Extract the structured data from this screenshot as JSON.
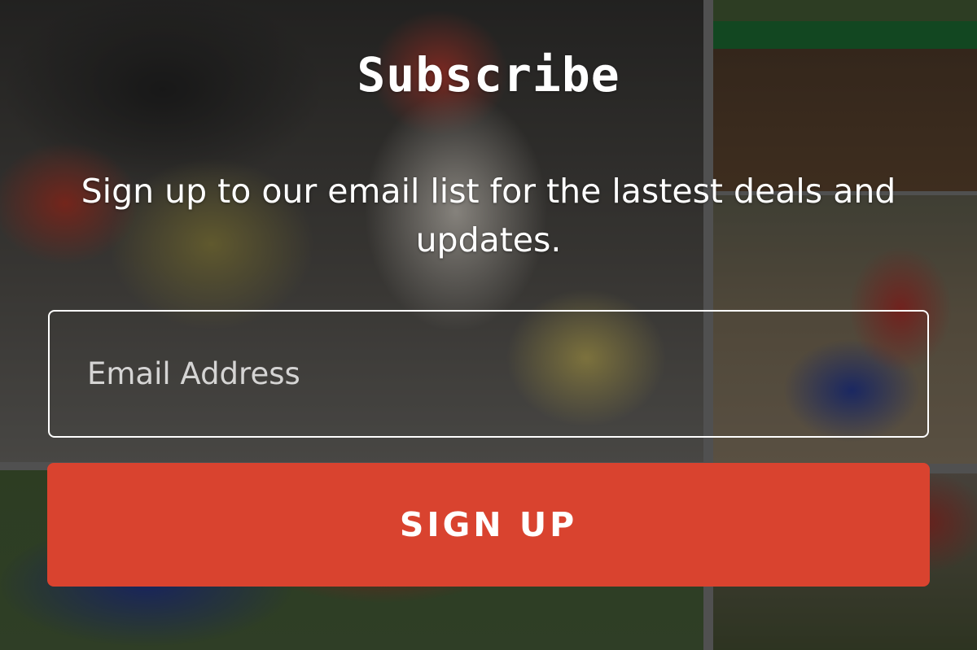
{
  "subscribe": {
    "title": "Subscribe",
    "description": "Sign up to our email list for the lastest deals and updates.",
    "email_placeholder": "Email Address",
    "email_value": "",
    "button_label": "SIGN UP"
  },
  "colors": {
    "accent": "#d9432f",
    "text": "#ffffff"
  }
}
